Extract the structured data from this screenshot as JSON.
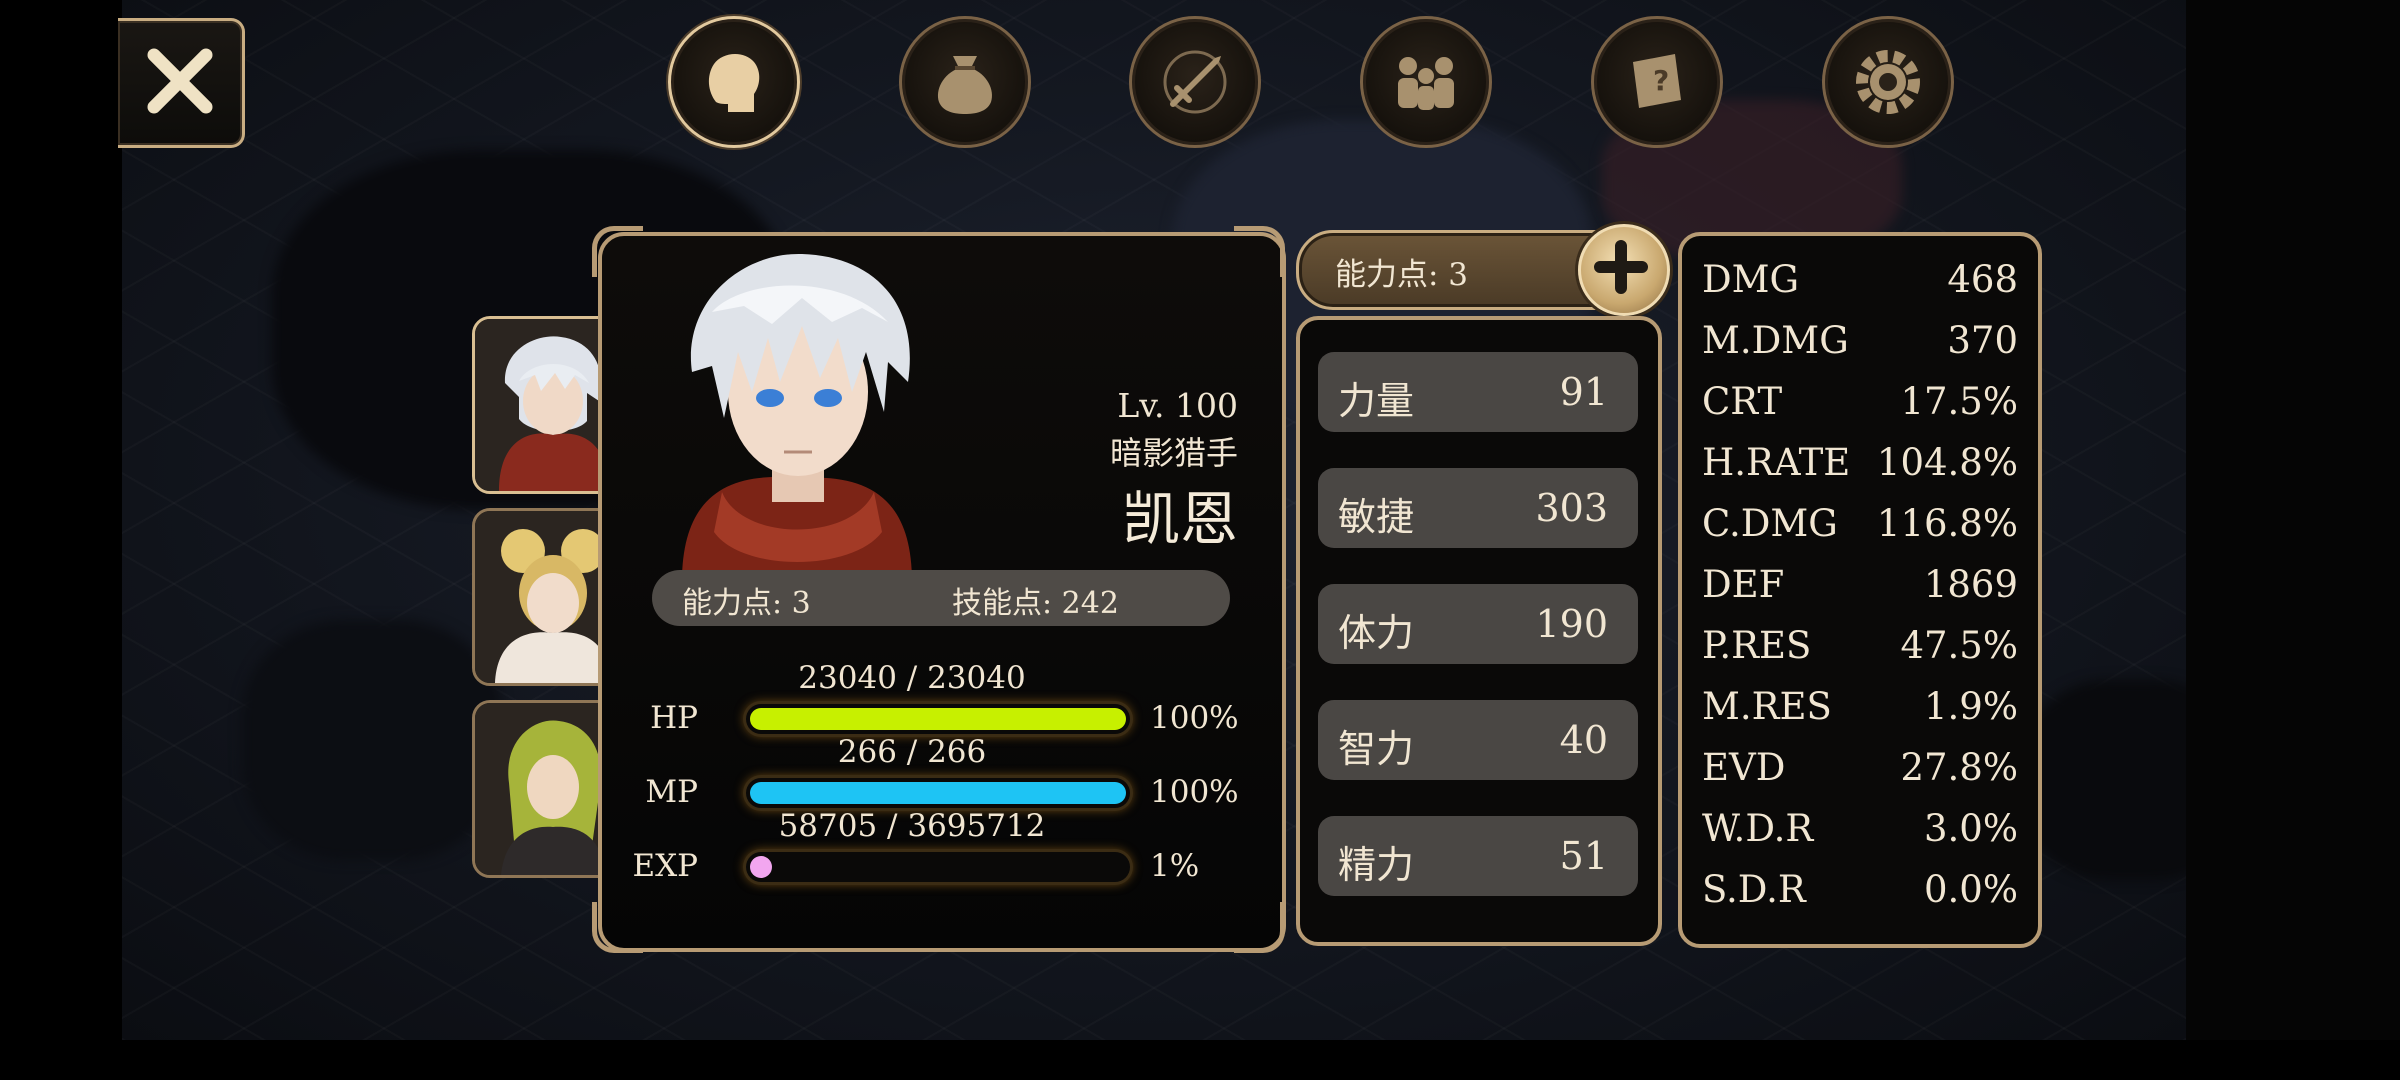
{
  "character": {
    "level": "Lv. 100",
    "class": "暗影猎手",
    "name": "凯恩",
    "ability_points": "能力点: 3",
    "skill_points": "技能点: 242"
  },
  "bars": [
    {
      "label": "HP",
      "value": "23040 / 23040",
      "percent": "100%",
      "fill": 1.0,
      "color": "#c7f000"
    },
    {
      "label": "MP",
      "value": "266 / 266",
      "percent": "100%",
      "fill": 1.0,
      "color": "#1ec4f4"
    },
    {
      "label": "EXP",
      "value": "58705 / 3695712",
      "percent": "1%",
      "fill": 0.016,
      "color": "#f2a6ef"
    }
  ],
  "stats_header": "能力点: 3",
  "stats": [
    {
      "label": "力量",
      "value": "91"
    },
    {
      "label": "敏捷",
      "value": "303"
    },
    {
      "label": "体力",
      "value": "190"
    },
    {
      "label": "智力",
      "value": "40"
    },
    {
      "label": "精力",
      "value": "51"
    }
  ],
  "attributes": [
    {
      "key": "DMG",
      "value": "468"
    },
    {
      "key": "M.DMG",
      "value": "370"
    },
    {
      "key": "CRT",
      "value": "17.5%"
    },
    {
      "key": "H.RATE",
      "value": "104.8%"
    },
    {
      "key": "C.DMG",
      "value": "116.8%"
    },
    {
      "key": "DEF",
      "value": "1869"
    },
    {
      "key": "P.RES",
      "value": "47.5%"
    },
    {
      "key": "M.RES",
      "value": "1.9%"
    },
    {
      "key": "EVD",
      "value": "27.8%"
    },
    {
      "key": "W.D.R",
      "value": "3.0%"
    },
    {
      "key": "S.D.R",
      "value": "0.0%"
    }
  ],
  "menu_icons": [
    "head-icon",
    "bag-icon",
    "weapon-icon",
    "party-icon",
    "quest-scroll-icon",
    "gear-icon"
  ],
  "colors": {
    "gold": "#b79b74",
    "hp": "#c7f000",
    "mp": "#1ec4f4",
    "exp": "#f2a6ef"
  }
}
